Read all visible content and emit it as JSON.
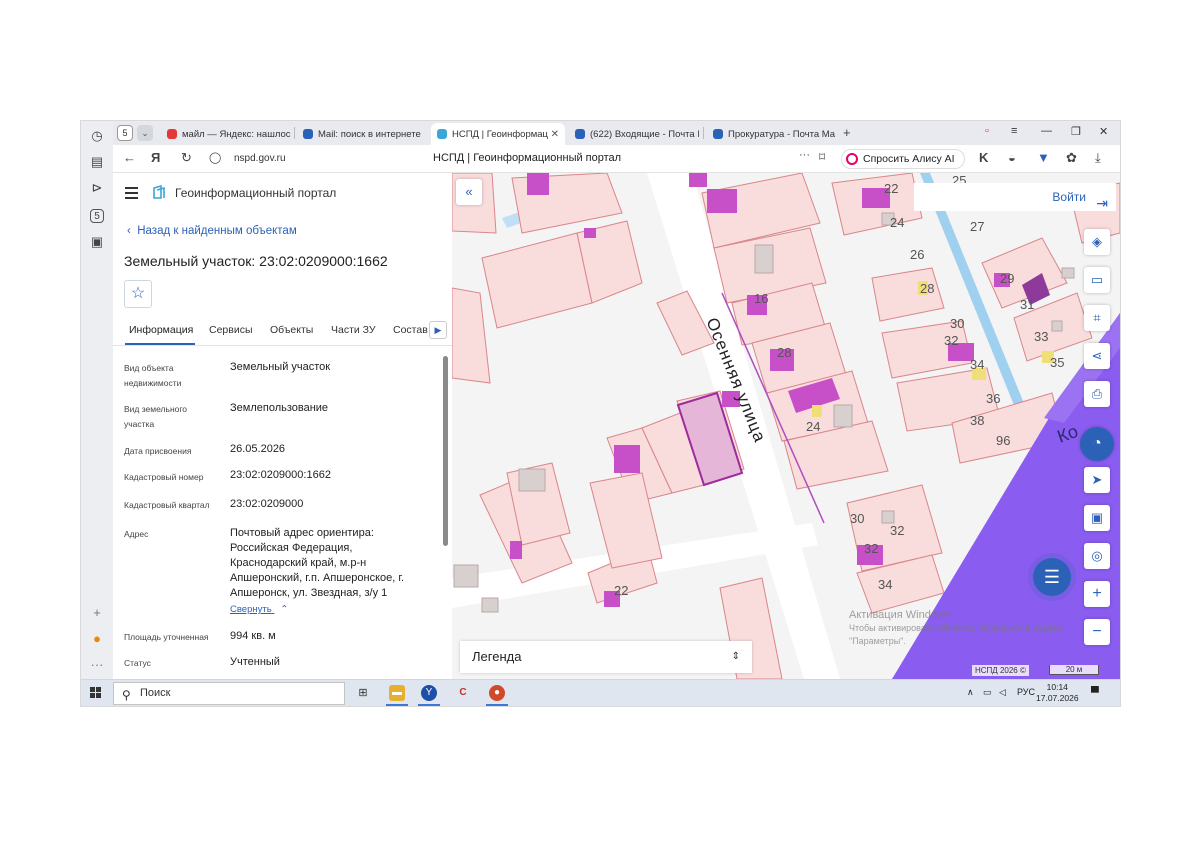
{
  "browser": {
    "tab_count": "5",
    "tabs": [
      {
        "label": "майл — Яндекс: нашлось",
        "color": "#e53935"
      },
      {
        "label": "Mail: поиск в интернете",
        "color": "#2b62b8"
      },
      {
        "label": "НСПД | Геоинформац",
        "color": "#3aa7d6",
        "active": true
      },
      {
        "label": "(622) Входящие - Почта M",
        "color": "#2b62b8"
      },
      {
        "label": "Прокуратура - Почта Ма",
        "color": "#2b62b8"
      }
    ],
    "url": "nspd.gov.ru",
    "page_title": "НСПД | Геоинформационный портал",
    "alice_label": "Спросить Алису AI",
    "menu_dots": "···"
  },
  "portal": {
    "name": "Геоинформационный портал",
    "back_link": "Назад к найденным объектам",
    "title": "Земельный участок: 23:02:0209000:1662",
    "tabs": [
      "Информация",
      "Сервисы",
      "Объекты",
      "Части ЗУ",
      "Состав"
    ],
    "properties": [
      {
        "label": [
          "Вид объекта",
          "недвижимости"
        ],
        "value": [
          "Земельный участок"
        ]
      },
      {
        "label": [
          "Вид земельного",
          "участка"
        ],
        "value": [
          "Землепользование"
        ]
      },
      {
        "label": [
          "Дата присвоения"
        ],
        "value": [
          "26.05.2026"
        ]
      },
      {
        "label": [
          "Кадастровый номер"
        ],
        "value": [
          "23:02:0209000:1662"
        ]
      },
      {
        "label": [
          "Кадастровый квартал"
        ],
        "value": [
          "23:02:0209000"
        ]
      },
      {
        "label": [
          "Адрес"
        ],
        "value": [
          "Почтовый адрес ориентира:",
          "Российская Федерация,",
          "Краснодарский край, м.р-н",
          "Апшеронский, г.п. Апшеронское, г.",
          "Апшеронск, ул. Звездная, з/у 1"
        ]
      },
      {
        "label": [
          "Площадь уточненная"
        ],
        "value": [
          "994 кв. м"
        ]
      },
      {
        "label": [
          "Статус"
        ],
        "value": [
          "Учтенный"
        ]
      }
    ],
    "collapse_link": "Свернуть"
  },
  "map": {
    "login_label": "Войти",
    "legend_label": "Легенда",
    "street_label": "Осенняя улица",
    "road_label": "Ко",
    "credit": "НСПД 2026 ©",
    "scale": "20 м",
    "activation_title": "Активация Windows",
    "activation_text_1": "Чтобы активировать Windows, перейдите в раздел",
    "activation_text_2": "\"Параметры\".",
    "house_numbers": [
      "25",
      "22",
      "24",
      "27",
      "26",
      "29",
      "31",
      "28",
      "16",
      "30",
      "33",
      "32",
      "35",
      "28",
      "34",
      "36",
      "24",
      "38",
      "96",
      "30",
      "32",
      "32",
      "34",
      "22"
    ],
    "colors": {
      "parcel_fill": "#f9dcdc",
      "parcel_stroke": "#d9868a",
      "building": "#c750c9",
      "selected": "#9e2a9e",
      "road": "#8a5cf0",
      "water": "#9fd0f0"
    }
  },
  "taskbar": {
    "search_placeholder": "Поиск",
    "lang": "РУС",
    "time": "10:14",
    "date": "17.07.2026"
  }
}
